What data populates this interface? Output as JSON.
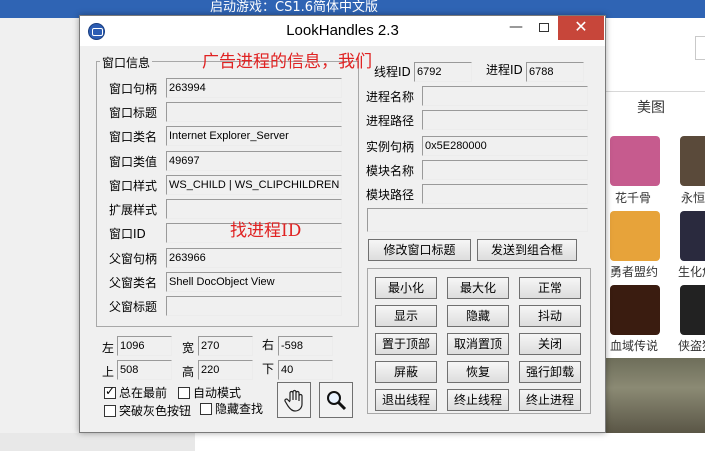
{
  "background": {
    "top_banner": "启动游戏：CS1.6简体中文版",
    "tab_label": "美图",
    "games": [
      {
        "label": "花千骨"
      },
      {
        "label": "永恒"
      },
      {
        "label": "勇者盟约"
      },
      {
        "label": "生化危"
      },
      {
        "label": "血域传说"
      },
      {
        "label": "侠盗猎"
      }
    ],
    "game_colors": [
      "#c65b8e",
      "#5a4a3a",
      "#e7a33a",
      "#2a2a3e",
      "#3a1c10",
      "#222222"
    ]
  },
  "window": {
    "title": "LookHandles 2.3",
    "min_glyph": "—",
    "close_glyph": "✕"
  },
  "window_info": {
    "group_title": "窗口信息",
    "rows": [
      {
        "label": "窗口句柄",
        "value": "263994"
      },
      {
        "label": "窗口标题",
        "value": ""
      },
      {
        "label": "窗口类名",
        "value": "Internet Explorer_Server"
      },
      {
        "label": "窗口类值",
        "value": "49697"
      },
      {
        "label": "窗口样式",
        "value": "WS_CHILD | WS_CLIPCHILDREN | W"
      },
      {
        "label": "扩展样式",
        "value": ""
      },
      {
        "label": "窗口ID",
        "value": ""
      },
      {
        "label": "父窗句柄",
        "value": "263966"
      },
      {
        "label": "父窗类名",
        "value": "Shell DocObject View"
      },
      {
        "label": "父窗标题",
        "value": ""
      }
    ]
  },
  "annotations": {
    "top": "广告进程的信息，我们",
    "middle": "找进程ID"
  },
  "process_info": {
    "thread_id_label": "线程ID",
    "thread_id": "6792",
    "process_id_label": "进程ID",
    "process_id": "6788",
    "rows": [
      {
        "label": "进程名称",
        "value": ""
      },
      {
        "label": "进程路径",
        "value": ""
      },
      {
        "label": "实例句柄",
        "value": "0x5E280000"
      },
      {
        "label": "模块名称",
        "value": ""
      },
      {
        "label": "模块路径",
        "value": ""
      }
    ]
  },
  "actions": {
    "modify_title": "修改窗口标题",
    "send_combo": "发送到组合框",
    "grid": [
      [
        "最小化",
        "最大化",
        "正常"
      ],
      [
        "显示",
        "隐藏",
        "抖动"
      ],
      [
        "置于顶部",
        "取消置顶",
        "关闭"
      ],
      [
        "屏蔽",
        "恢复",
        "强行卸载"
      ],
      [
        "退出线程",
        "终止线程",
        "终止进程"
      ]
    ]
  },
  "position": {
    "left_label": "左",
    "left": "1096",
    "width_label": "宽",
    "width": "270",
    "right_label": "右",
    "right": "-598",
    "top_label": "上",
    "top": "508",
    "height_label": "高",
    "height": "220",
    "bottom_label": "下",
    "bottom": "40"
  },
  "options": {
    "always_on_top": "总在最前",
    "always_on_top_checked": true,
    "auto_mode": "自动模式",
    "auto_mode_checked": false,
    "break_gray": "突破灰色按钮",
    "break_gray_checked": false,
    "hidden_find": "隐藏查找",
    "hidden_find_checked": false
  },
  "tools": {
    "hand_icon": "hand-icon",
    "magnifier_icon": "magnifier-icon"
  }
}
